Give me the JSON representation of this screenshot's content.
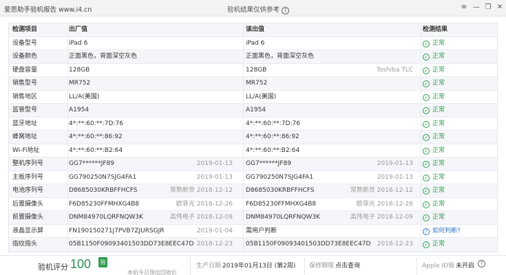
{
  "window": {
    "app_title": "爱思助手验机报告 www.i4.cn",
    "center_title": "验机结果仅供参考",
    "help_glyph": "?",
    "controls": [
      "≡",
      "—",
      "❐",
      "✕"
    ]
  },
  "table": {
    "headers": {
      "name": "检测项目",
      "factory": "出厂值",
      "read": "读出值",
      "result": "检测结果"
    },
    "rows": [
      {
        "name": "设备型号",
        "factory": "iPad 6",
        "factory_sub": "",
        "read": "iPad 6",
        "read_sub": "",
        "result": "正常",
        "status": "ok"
      },
      {
        "name": "设备颜色",
        "factory": "正面黑色，背面深空灰色",
        "factory_sub": "",
        "read": "正面黑色，背面深空灰色",
        "read_sub": "",
        "result": "正常",
        "status": "ok"
      },
      {
        "name": "硬盘容量",
        "factory": "128GB",
        "factory_sub": "",
        "read": "128GB",
        "read_sub": "Toshiba TLC",
        "result": "正常",
        "status": "ok"
      },
      {
        "name": "销售型号",
        "factory": "MR752",
        "factory_sub": "",
        "read": "MR752",
        "read_sub": "",
        "result": "正常",
        "status": "ok"
      },
      {
        "name": "销售地区",
        "factory": "LL/A(美国)",
        "factory_sub": "",
        "read": "LL/A(美国)",
        "read_sub": "",
        "result": "正常",
        "status": "ok"
      },
      {
        "name": "监管型号",
        "factory": "A1954",
        "factory_sub": "",
        "read": "A1954",
        "read_sub": "",
        "result": "正常",
        "status": "ok"
      },
      {
        "name": "蓝牙地址",
        "factory": "4*:**:60:**:7D:76",
        "factory_sub": "",
        "read": "4*:**:60:**:7D:76",
        "read_sub": "",
        "result": "正常",
        "status": "ok"
      },
      {
        "name": "蜂窝地址",
        "factory": "4*:**:60:**:86:92",
        "factory_sub": "",
        "read": "4*:**:60:**:86:92",
        "read_sub": "",
        "result": "正常",
        "status": "ok"
      },
      {
        "name": "Wi-Fi地址",
        "factory": "4*:**:60:**:B2:64",
        "factory_sub": "",
        "read": "4*:**:60:**:B2:64",
        "read_sub": "",
        "result": "正常",
        "status": "ok"
      },
      {
        "name": "整机序列号",
        "factory": "GG7******JF89",
        "factory_sub": "2019-01-13",
        "read": "GG7******JF89",
        "read_sub": "2019-01-13",
        "result": "正常",
        "status": "ok"
      },
      {
        "name": "主板序列号",
        "factory": "GG790250N7SJG4FA1",
        "factory_sub": "2019-01-13",
        "read": "GG790250N7SJG4FA1",
        "read_sub": "2019-01-13",
        "result": "正常",
        "status": "ok"
      },
      {
        "name": "电池序列号",
        "factory": "D8685030KRBFFHCFS",
        "factory_sub": "常熟新世 2018-12-12",
        "read": "D8685030KRBFFHCFS",
        "read_sub": "常熟新世 2018-12-12",
        "result": "正常",
        "status": "ok"
      },
      {
        "name": "后置摄像头",
        "factory": "F6D85230FFMHXG4B8",
        "factory_sub": "欧菲光 2018-12-26",
        "read": "F6D85230FFMHXG4B8",
        "read_sub": "欧菲光 2018-12-26",
        "result": "正常",
        "status": "ok"
      },
      {
        "name": "前置摄像头",
        "factory": "DNM84970LQRFNQW3K",
        "factory_sub": "高伟电子 2018-12-09",
        "read": "DNM84970LQRFNQW3K",
        "read_sub": "高伟电子 2018-12-09",
        "result": "正常",
        "status": "ok"
      },
      {
        "name": "液晶显示屏",
        "factory": "FN190150271J7PVB7ZJURSGJR",
        "factory_sub": "2019-01-04",
        "read": "需用户判断",
        "read_sub": "",
        "result": "如何判断?",
        "status": "query"
      },
      {
        "name": "指纹指头",
        "factory": "05B1150F09093401503DD73E8EEC47D",
        "factory_sub": "2018-12-23",
        "read": "05B1150F09093401503DD73E8EEC47D",
        "read_sub": "2018-12-23",
        "result": "正常",
        "status": "ok"
      }
    ]
  },
  "footer": {
    "score_label": "验机评分",
    "score_value": "100",
    "badge": "验",
    "note": "本机今日预估回收价",
    "production_label": "生产日期",
    "production_value": "2019年01月13日 (第2周)",
    "warranty_label": "保修期限",
    "warranty_link": "点击查询",
    "appleid_label": "Apple ID锁",
    "appleid_value": "未开启",
    "help_glyph": "?"
  },
  "colors": {
    "ok_green": "#2e9c4b",
    "link_blue": "#2f74c0",
    "score_green": "#2e8b57"
  }
}
